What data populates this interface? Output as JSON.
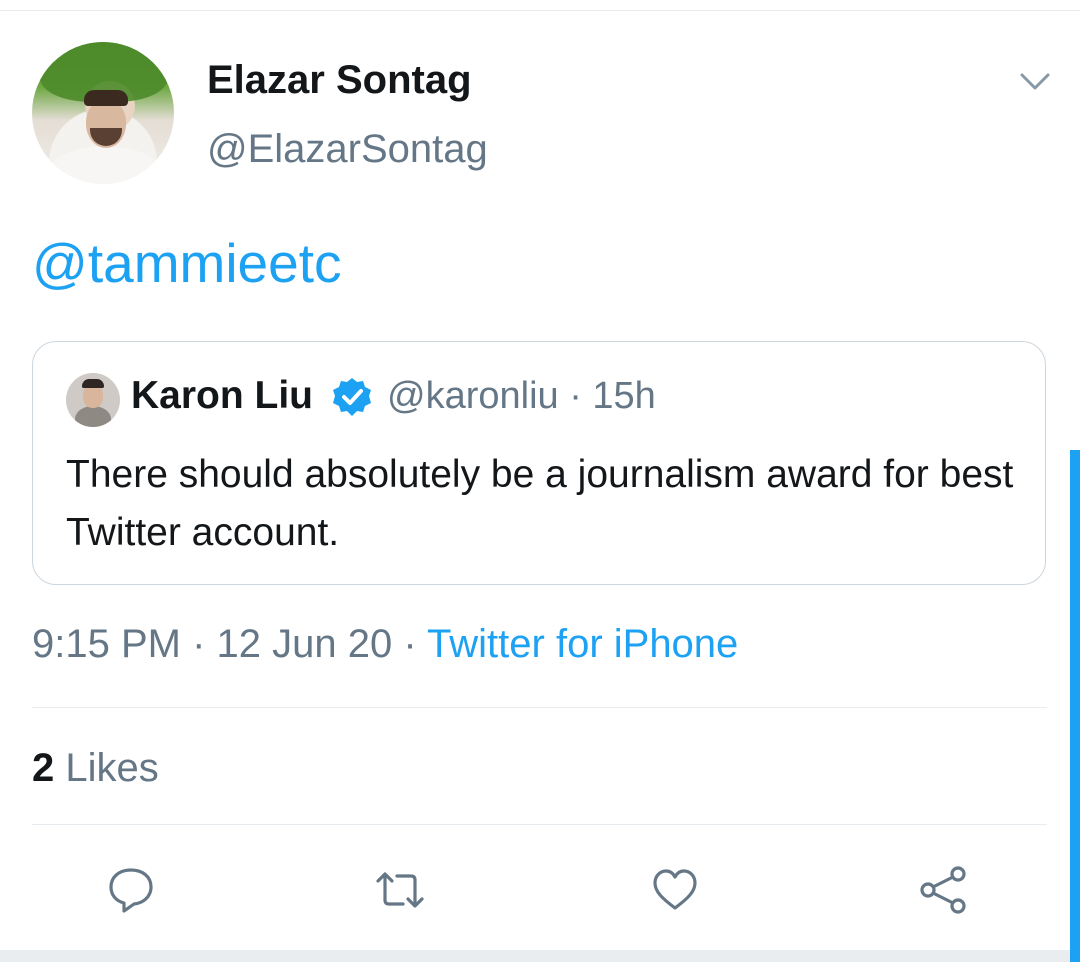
{
  "tweet": {
    "author": {
      "display_name": "Elazar Sontag",
      "handle": "@ElazarSontag"
    },
    "text": "@tammieetc",
    "quoted": {
      "display_name": "Karon Liu",
      "verified": true,
      "meta": "@karonliu · 15h",
      "text": "There should absolutely be a journalism award for best Twitter account."
    },
    "timestamp": "9:15 PM · 12 Jun 20 · ",
    "source": "Twitter for iPhone",
    "likes": {
      "count": "2",
      "label": " Likes"
    }
  },
  "actions": [
    {
      "name": "reply",
      "icon": "reply-icon"
    },
    {
      "name": "retweet",
      "icon": "retweet-icon"
    },
    {
      "name": "like",
      "icon": "heart-icon"
    },
    {
      "name": "share",
      "icon": "share-icon"
    }
  ],
  "colors": {
    "accent": "#1da1f2",
    "secondary_text": "#657786",
    "divider": "#e6ecf0"
  }
}
